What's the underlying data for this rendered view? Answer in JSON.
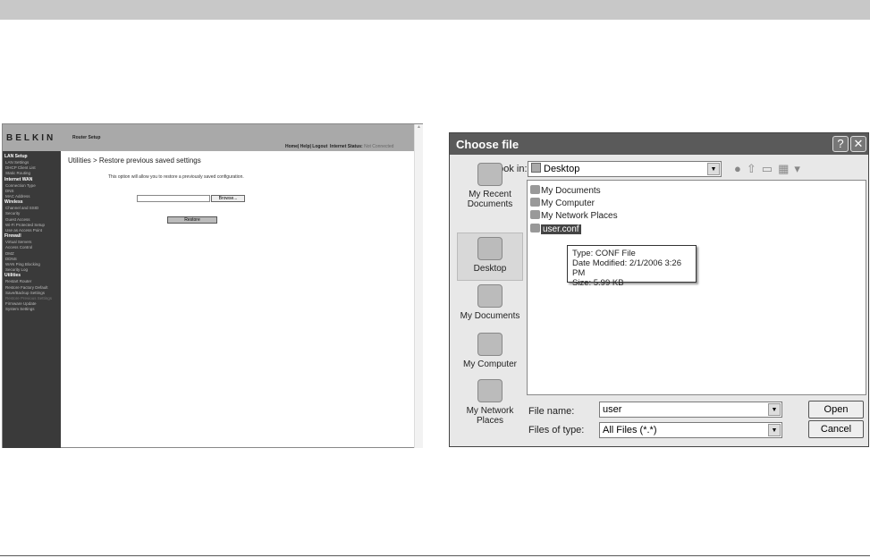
{
  "router": {
    "logo": "BELKIN",
    "setup_label": "Router Setup",
    "nav": {
      "links": "Home| Help| Logout",
      "status_label": "Internet Status:",
      "status_value": "Not Connected"
    },
    "sidebar": [
      {
        "section": "LAN Setup",
        "items": [
          "LAN Settings",
          "DHCP Client List",
          "Static Routing"
        ]
      },
      {
        "section": "Internet WAN",
        "items": [
          "Connection Type",
          "DNS",
          "MAC Address"
        ]
      },
      {
        "section": "Wireless",
        "items": [
          "Channel and SSID",
          "Security",
          "Guest Access",
          "Wi-Fi Protected Setup",
          "Use as Access Point"
        ]
      },
      {
        "section": "Firewall",
        "items": [
          "Virtual Servers",
          "Access Control",
          "DMZ",
          "DDNS",
          "WAN Ping Blocking",
          "Security Log"
        ]
      },
      {
        "section": "Utilities",
        "items": [
          "Restart Router",
          "Restore Factory Default",
          "Save/Backup Settings",
          "Restore Previous Settings",
          "Firmware Update",
          "System Settings"
        ]
      }
    ],
    "page_title": "Utilities > Restore previous saved settings",
    "description": "This option will allow you to restore a previously saved configuration.",
    "file_value": "",
    "browse_label": "Browse...",
    "restore_label": "Restore"
  },
  "dialog": {
    "title": "Choose file",
    "help": "?",
    "close": "✕",
    "look_in_label": "Look in:",
    "look_in_value": "Desktop",
    "places": [
      "My Recent Documents",
      "Desktop",
      "My Documents",
      "My Computer",
      "My Network Places"
    ],
    "files": [
      "My Documents",
      "My Computer",
      "My Network Places",
      "user.conf"
    ],
    "tooltip": [
      "Type: CONF File",
      "Date Modified: 2/1/2006 3:26 PM",
      "Size: 5.99 KB"
    ],
    "file_name_label": "File name:",
    "file_name_value": "user",
    "file_type_label": "Files of type:",
    "file_type_value": "All Files (*.*)",
    "open_label": "Open",
    "cancel_label": "Cancel"
  }
}
